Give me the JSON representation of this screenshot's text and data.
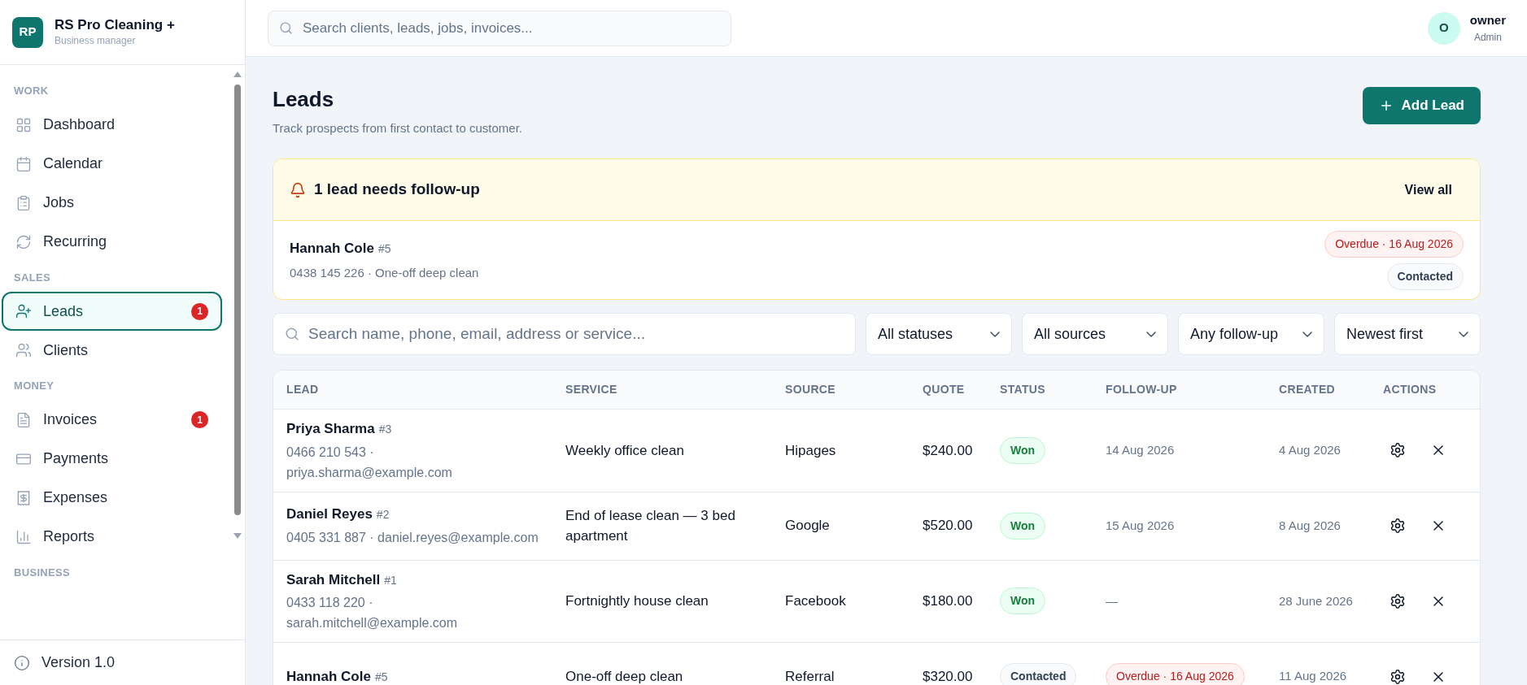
{
  "brand": {
    "initials": "RP",
    "name": "RS Pro Cleaning +",
    "subtitle": "Business manager"
  },
  "sidebar": {
    "sections": [
      {
        "label": "WORK",
        "items": [
          {
            "label": "Dashboard",
            "selected": false
          },
          {
            "label": "Calendar",
            "selected": false
          },
          {
            "label": "Jobs",
            "selected": false
          },
          {
            "label": "Recurring",
            "selected": false
          }
        ]
      },
      {
        "label": "SALES",
        "items": [
          {
            "label": "Leads",
            "selected": true,
            "badge": "1"
          },
          {
            "label": "Clients",
            "selected": false
          }
        ]
      },
      {
        "label": "MONEY",
        "items": [
          {
            "label": "Invoices",
            "selected": false,
            "badge": "1"
          },
          {
            "label": "Payments",
            "selected": false
          },
          {
            "label": "Expenses",
            "selected": false
          },
          {
            "label": "Reports",
            "selected": false
          }
        ]
      },
      {
        "label": "BUSINESS"
      }
    ],
    "footer": "Version 1.0"
  },
  "topbar": {
    "search_placeholder": "Search clients, leads, jobs, invoices...",
    "user": {
      "initial": "O",
      "name": "owner",
      "role": "Admin"
    }
  },
  "page": {
    "title": "Leads",
    "subtitle": "Track prospects from first contact to customer.",
    "add_button": "Add Lead"
  },
  "follow_up_alert": {
    "title": "1 lead needs follow-up",
    "view_all": "View all",
    "items": [
      {
        "name": "Hannah Cole",
        "number": "#5",
        "detail": "0438 145 226 · One-off deep clean",
        "due": "Overdue · 16 Aug 2026",
        "status": {
          "label": "Contacted",
          "kind": "contacted"
        }
      }
    ]
  },
  "filters": {
    "search_placeholder": "Search name, phone, email, address or service...",
    "selects": [
      "All statuses",
      "All sources",
      "Any follow-up",
      "Newest first"
    ]
  },
  "table": {
    "columns": [
      "LEAD",
      "SERVICE",
      "SOURCE",
      "QUOTE",
      "STATUS",
      "FOLLOW-UP",
      "CREATED",
      "ACTIONS"
    ],
    "rows": [
      {
        "name": "Priya Sharma",
        "number": "#3",
        "contact": "0466 210 543 · priya.sharma@example.com",
        "service": "Weekly office clean",
        "source": "Hipages",
        "quote": "$240.00",
        "status": {
          "label": "Won",
          "kind": "won"
        },
        "follow_up": {
          "label": "14 Aug 2026",
          "kind": "date"
        },
        "created": "4 Aug 2026"
      },
      {
        "name": "Daniel Reyes",
        "number": "#2",
        "contact": "0405 331 887 · daniel.reyes@example.com",
        "service": "End of lease clean — 3 bed apartment",
        "source": "Google",
        "quote": "$520.00",
        "status": {
          "label": "Won",
          "kind": "won"
        },
        "follow_up": {
          "label": "15 Aug 2026",
          "kind": "date"
        },
        "created": "8 Aug 2026"
      },
      {
        "name": "Sarah Mitchell",
        "number": "#1",
        "contact": "0433 118 220 · sarah.mitchell@example.com",
        "service": "Fortnightly house clean",
        "source": "Facebook",
        "quote": "$180.00",
        "status": {
          "label": "Won",
          "kind": "won"
        },
        "follow_up": {
          "label": "—",
          "kind": "date"
        },
        "created": "28 June 2026"
      },
      {
        "name": "Hannah Cole",
        "number": "#5",
        "service": "One-off deep clean",
        "source": "Referral",
        "quote": "$320.00",
        "status": {
          "label": "Contacted",
          "kind": "contacted"
        },
        "follow_up": {
          "label": "Overdue · 16 Aug 2026",
          "kind": "overdue"
        },
        "created": "11 Aug 2026"
      }
    ]
  }
}
